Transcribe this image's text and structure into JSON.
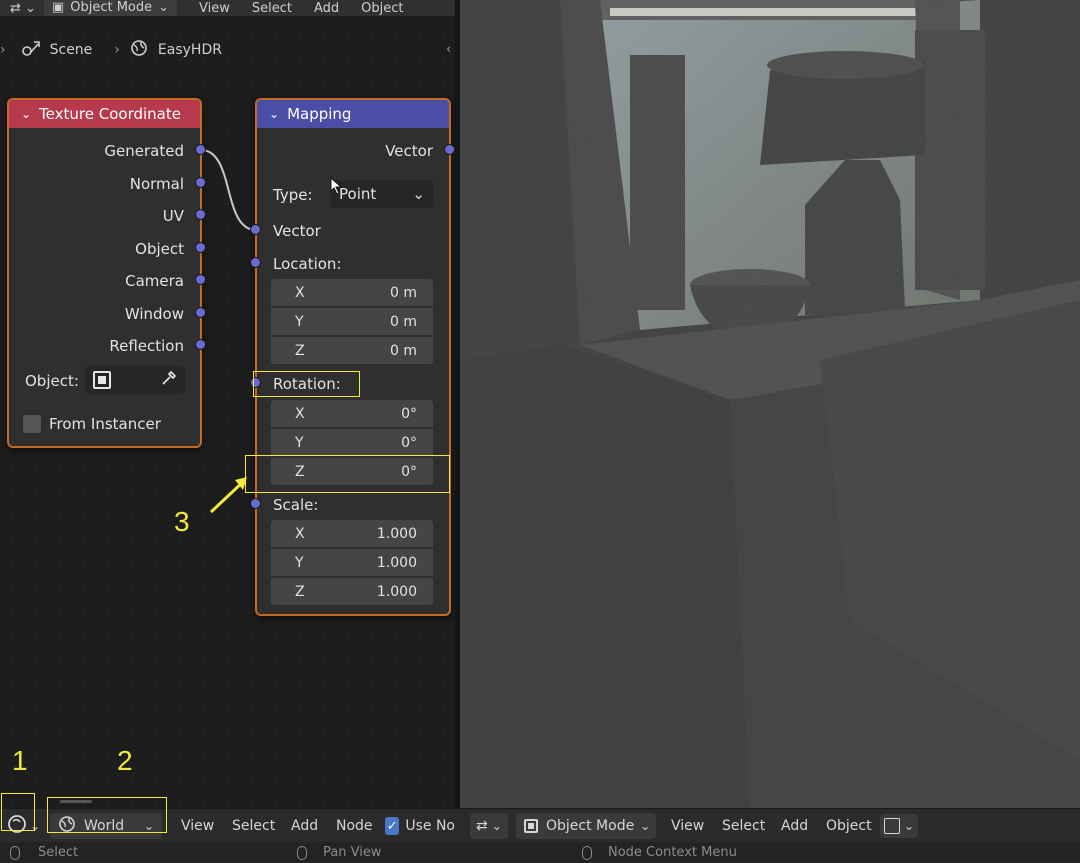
{
  "top_header": {
    "mode": "Object Mode",
    "menu": [
      "View",
      "Select",
      "Add",
      "Object"
    ]
  },
  "breadcrumb": {
    "scene": "Scene",
    "world": "EasyHDR"
  },
  "texture_coordinate_node": {
    "title": "Texture Coordinate",
    "outputs": [
      "Generated",
      "Normal",
      "UV",
      "Object",
      "Camera",
      "Window",
      "Reflection"
    ],
    "object_label": "Object:",
    "from_instancer": "From Instancer"
  },
  "mapping_node": {
    "title": "Mapping",
    "output": "Vector",
    "type_label": "Type:",
    "type_value": "Point",
    "vector_input": "Vector",
    "location": {
      "label": "Location:",
      "x": "0 m",
      "y": "0 m",
      "z": "0 m"
    },
    "rotation": {
      "label": "Rotation:",
      "x": "0°",
      "y": "0°",
      "z": "0°"
    },
    "scale": {
      "label": "Scale:",
      "x": "1.000",
      "y": "1.000",
      "z": "1.000"
    },
    "axis_labels": [
      "X",
      "Y",
      "Z"
    ]
  },
  "annotations": {
    "one": "1",
    "two": "2",
    "three": "3"
  },
  "node_editor_header": {
    "shader_type": "World",
    "menu": [
      "View",
      "Select",
      "Add",
      "Node"
    ],
    "use_nodes": "Use No"
  },
  "viewport_header": {
    "mode": "Object Mode",
    "menu": [
      "View",
      "Select",
      "Add",
      "Object"
    ]
  },
  "status_bar": {
    "select": "Select",
    "pan": "Pan View",
    "context": "Node Context Menu"
  },
  "colors": {
    "accent_highlight": "#f3ea3c",
    "texture_header": "#b63a4b",
    "mapping_header": "#4a4ea6",
    "socket": "#6b6ad0",
    "node_border": "#c66a22"
  }
}
